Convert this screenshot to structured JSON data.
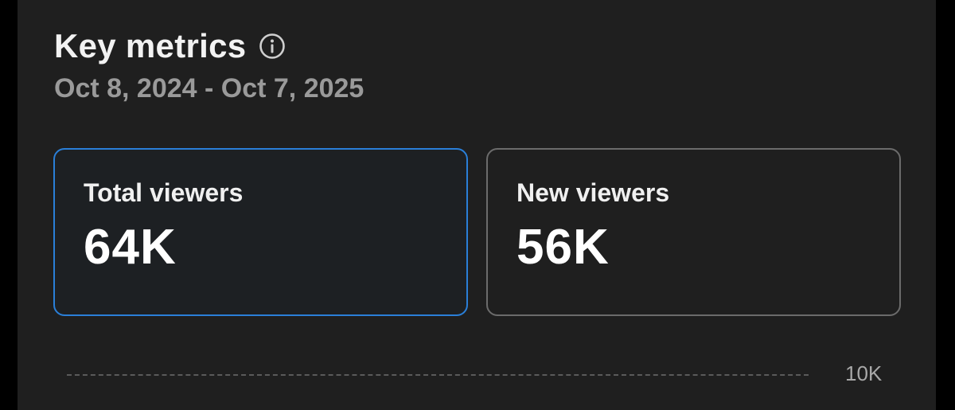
{
  "header": {
    "title": "Key metrics",
    "info_icon": "info-icon",
    "date_range": "Oct 8, 2024 - Oct 7, 2025"
  },
  "cards": [
    {
      "label": "Total viewers",
      "value": "64K",
      "selected": true
    },
    {
      "label": "New viewers",
      "value": "56K",
      "selected": false
    }
  ],
  "chart": {
    "y_tick_label": "10K"
  },
  "colors": {
    "panel_background": "#1f1f1f",
    "selected_border": "#2a7fd8",
    "unselected_border": "#6b6b6b",
    "muted_text": "#9a9a9a"
  }
}
